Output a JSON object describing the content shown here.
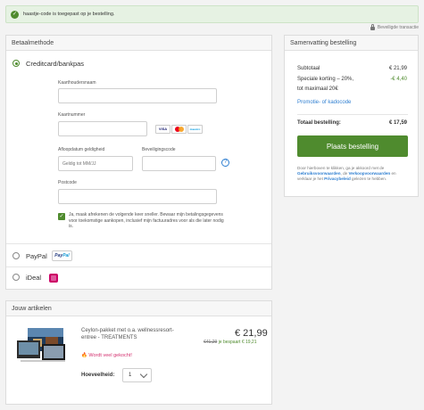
{
  "alert": {
    "text": "haastje-code is toegepast op je bestelling."
  },
  "secure_text": "Beveiligde transactie",
  "payment": {
    "title": "Betaalmethode",
    "creditcard_label": "Creditcard/bankpas",
    "cardholder_label": "Kaarthoudersnaam",
    "cardnumber_label": "Kaartnummer",
    "expiry_label": "Afloopdatum geldigheid",
    "expiry_placeholder": "Geldig tot MM/JJ",
    "cvc_label": "Beveiligingscode",
    "postcode_label": "Postcode",
    "card_logos": [
      "VISA",
      "mastercard",
      "maestro"
    ],
    "save_text": "Ja, maak afrekenen de volgende keer sneller. Bewaar mijn betalingsgegevens voor toekomstige aankopen, inclusief mijn factuuradres voor als die later nodig is.",
    "paypal_label": "PayPal",
    "ideal_label": "iDeal"
  },
  "summary": {
    "title": "Samenvatting bestelling",
    "subtotal_label": "Subtotaal",
    "subtotal_value": "€ 21,99",
    "discount_label_1": "Speciale korting – 20%,",
    "discount_label_2": "tot maximaal 20€",
    "discount_value": "-€ 4,40",
    "promo_link": "Promotie- of kadocode",
    "total_label": "Totaal bestelling:",
    "total_value": "€ 17,59",
    "order_button": "Plaats bestelling",
    "fine_1": "Door hierboven te klikken, ga je akkoord met de",
    "fine_link_1": "Gebruiksvoorwaarden",
    "fine_2": ", de",
    "fine_link_2": "Verkoopvoorwaarden",
    "fine_3": "en verklaar je het",
    "fine_link_3": "Privacybeleid",
    "fine_4": "gelezen te hebben."
  },
  "items": {
    "title": "Jouw artikelen",
    "product_title": "Ceylon-pakket met o.a. wellnessresort-entree - TREATMENTS",
    "price": "€ 21,99",
    "old_price": "€41,29",
    "saving": "je bespaart € 19,21",
    "hot_text": "Wordt veel gekocht!",
    "qty_label": "Hoeveelheid:",
    "qty_value": "1"
  },
  "colors": {
    "accent": "#4f8b2e",
    "link": "#2f7fd1",
    "hot": "#d4306f"
  }
}
